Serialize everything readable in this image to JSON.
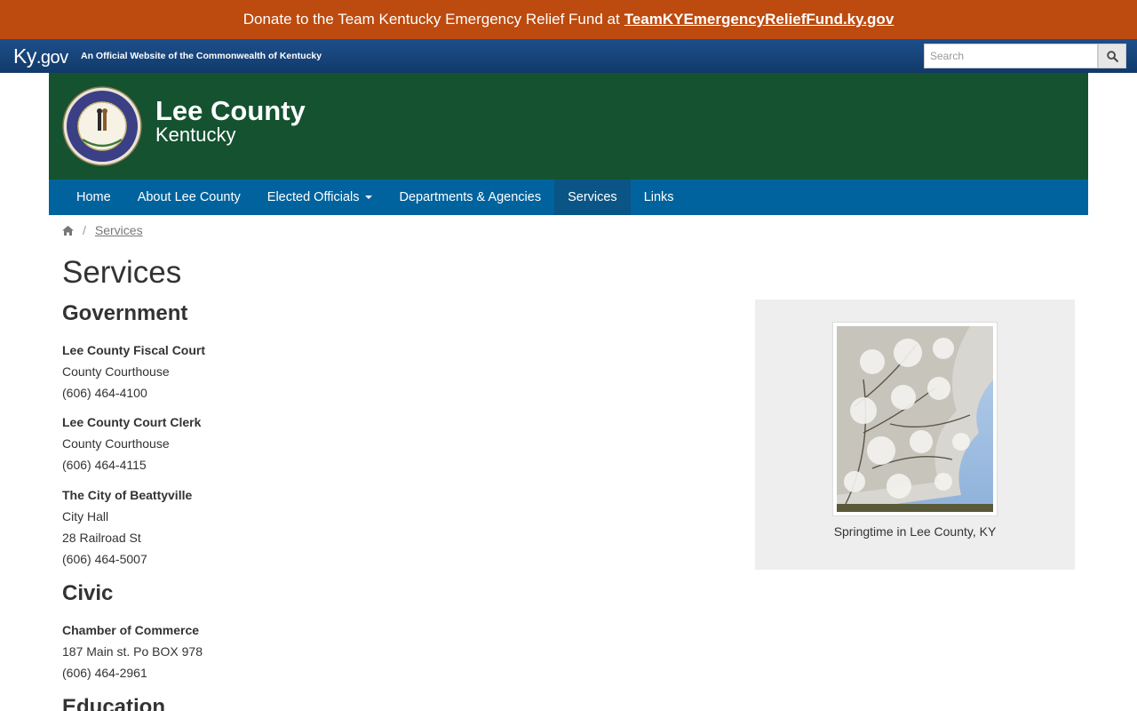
{
  "banner": {
    "text": "Donate to the Team Kentucky Emergency Relief Fund at",
    "link": "TeamKYEmergencyReliefFund.ky.gov"
  },
  "kygov": {
    "logo_main": "Ky",
    "logo_suffix": ".gov",
    "official_text": "An Official Website of the Commonwealth of Kentucky",
    "search_placeholder": "Search"
  },
  "header": {
    "title": "Lee County",
    "subtitle": "Kentucky",
    "seal_text_top": "COMMONWEALTH OF KENTUCKY",
    "seal_text_inner": "UNITED WE STAND · DIVIDED WE FALL"
  },
  "nav": {
    "items": [
      {
        "label": "Home"
      },
      {
        "label": "About Lee County"
      },
      {
        "label": "Elected Officials"
      },
      {
        "label": "Departments & Agencies"
      },
      {
        "label": "Services"
      },
      {
        "label": "Links"
      }
    ],
    "active": "Services"
  },
  "breadcrumb": {
    "current": "Services"
  },
  "page": {
    "title": "Services",
    "sections": [
      {
        "heading": "Government",
        "orgs": [
          {
            "name": "Lee County Fiscal Court",
            "line1": "County Courthouse",
            "line2": "(606) 464-4100"
          },
          {
            "name": "Lee County Court Clerk",
            "line1": "County Courthouse",
            "line2": "(606) 464-4115"
          },
          {
            "name": "The City of Beattyville",
            "line1": "City Hall",
            "line2": "28 Railroad St",
            "line3": "(606) 464-5007"
          }
        ]
      },
      {
        "heading": "Civic",
        "orgs": [
          {
            "name": "Chamber of Commerce",
            "line1": "187 Main st. Po BOX 978",
            "line2": "(606) 464-2961"
          }
        ]
      },
      {
        "heading": "Education"
      }
    ]
  },
  "sidebar": {
    "caption": "Springtime in Lee County, KY"
  },
  "colors": {
    "banner": "#bd4a0e",
    "header_green": "#145230",
    "nav_blue": "#00639e",
    "nav_active": "#0a5585"
  }
}
